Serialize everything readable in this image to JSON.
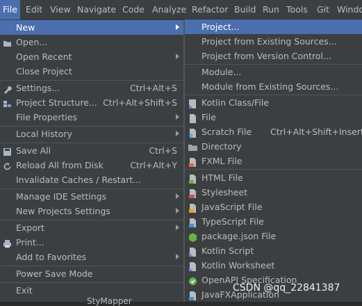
{
  "menubar": {
    "items": [
      {
        "label": "File",
        "active": true
      },
      {
        "label": "Edit"
      },
      {
        "label": "View"
      },
      {
        "label": "Navigate"
      },
      {
        "label": "Code"
      },
      {
        "label": "Analyze"
      },
      {
        "label": "Refactor"
      },
      {
        "label": "Build"
      },
      {
        "label": "Run"
      },
      {
        "label": "Tools"
      },
      {
        "label": "Git"
      },
      {
        "label": "Windo"
      }
    ]
  },
  "file_menu": {
    "items": [
      {
        "label": "New",
        "submenu": true,
        "selected": true
      },
      {
        "label": "Open...",
        "icon": "folder-icon"
      },
      {
        "label": "Open Recent",
        "submenu": true
      },
      {
        "label": "Close Project"
      },
      {
        "label": "Settings...",
        "shortcut": "Ctrl+Alt+S",
        "icon": "wrench-icon"
      },
      {
        "label": "Project Structure...",
        "shortcut": "Ctrl+Alt+Shift+S",
        "icon": "project-structure-icon"
      },
      {
        "label": "File Properties",
        "submenu": true
      },
      {
        "label": "Local History",
        "submenu": true
      },
      {
        "label": "Save All",
        "shortcut": "Ctrl+S",
        "icon": "save-icon"
      },
      {
        "label": "Reload All from Disk",
        "shortcut": "Ctrl+Alt+Y",
        "icon": "reload-icon"
      },
      {
        "label": "Invalidate Caches / Restart..."
      },
      {
        "label": "Manage IDE Settings",
        "submenu": true
      },
      {
        "label": "New Projects Settings",
        "submenu": true
      },
      {
        "label": "Export",
        "submenu": true
      },
      {
        "label": "Print...",
        "icon": "print-icon"
      },
      {
        "label": "Add to Favorites",
        "submenu": true
      },
      {
        "label": "Power Save Mode"
      },
      {
        "label": "Exit"
      }
    ]
  },
  "new_submenu": {
    "items": [
      {
        "label": "Project...",
        "selected": true
      },
      {
        "label": "Project from Existing Sources..."
      },
      {
        "label": "Project from Version Control..."
      },
      {
        "label": "Module..."
      },
      {
        "label": "Module from Existing Sources..."
      },
      {
        "label": "Kotlin Class/File",
        "icon": "kotlin-file-icon"
      },
      {
        "label": "File",
        "icon": "file-icon"
      },
      {
        "label": "Scratch File",
        "shortcut": "Ctrl+Alt+Shift+Insert",
        "icon": "scratch-file-icon"
      },
      {
        "label": "Directory",
        "icon": "directory-icon"
      },
      {
        "label": "FXML File",
        "icon": "fxml-file-icon"
      },
      {
        "label": "HTML File",
        "icon": "html-file-icon"
      },
      {
        "label": "Stylesheet",
        "icon": "css-file-icon"
      },
      {
        "label": "JavaScript File",
        "icon": "js-file-icon"
      },
      {
        "label": "TypeScript File",
        "icon": "ts-file-icon"
      },
      {
        "label": "package.json File",
        "icon": "package-json-icon"
      },
      {
        "label": "Kotlin Script",
        "icon": "kotlin-script-icon"
      },
      {
        "label": "Kotlin Worksheet",
        "icon": "kotlin-worksheet-icon"
      },
      {
        "label": "OpenAPI Specification",
        "icon": "openapi-icon"
      },
      {
        "label": "JavaFXApplication",
        "icon": "javafx-icon"
      }
    ]
  },
  "watermark": "CSDN @qq_22841387",
  "partial_bottom_text": "StyMapper",
  "colors": {
    "accent": "#4b6eaf",
    "menu_bg": "#3c3f41",
    "text": "#bbbbbb"
  }
}
